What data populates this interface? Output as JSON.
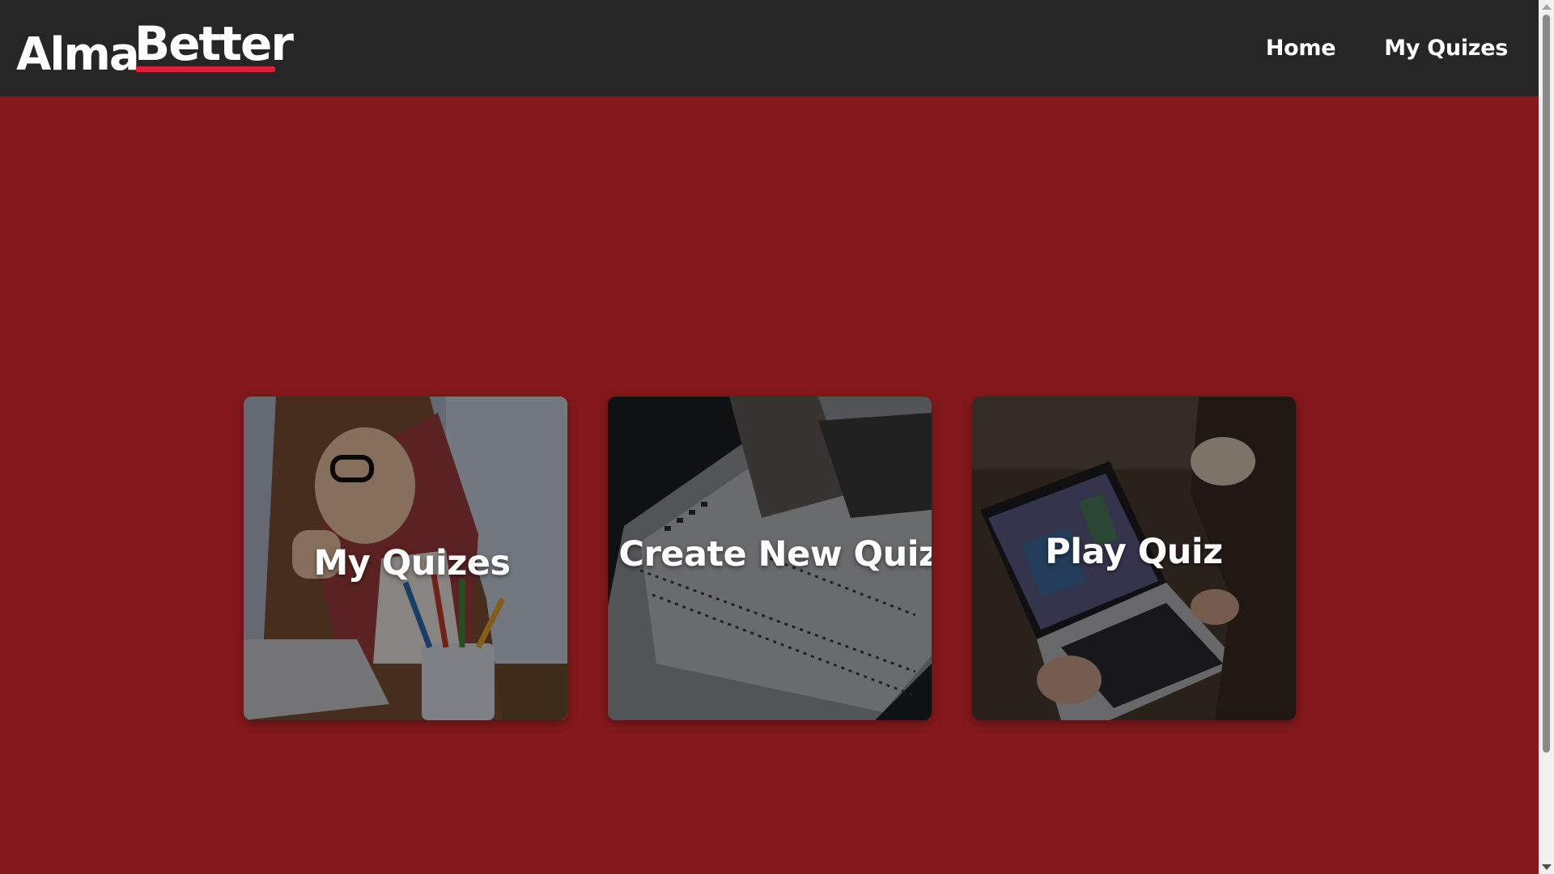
{
  "brand": {
    "part1": "Alma",
    "part2": "Better",
    "accent_color": "#e01e37"
  },
  "nav": {
    "links": [
      {
        "label": "Home"
      },
      {
        "label": "My Quizes"
      }
    ]
  },
  "cards": [
    {
      "title": "My Quizes",
      "image": "student-with-pencils-photo"
    },
    {
      "title": "Create New Quiz",
      "image": "answer-sheet-photo"
    },
    {
      "title": "Play Quiz",
      "image": "laptop-quiz-game-photo"
    }
  ],
  "colors": {
    "page_background": "#84181c",
    "navbar_background": "#262626",
    "text": "#ffffff"
  }
}
